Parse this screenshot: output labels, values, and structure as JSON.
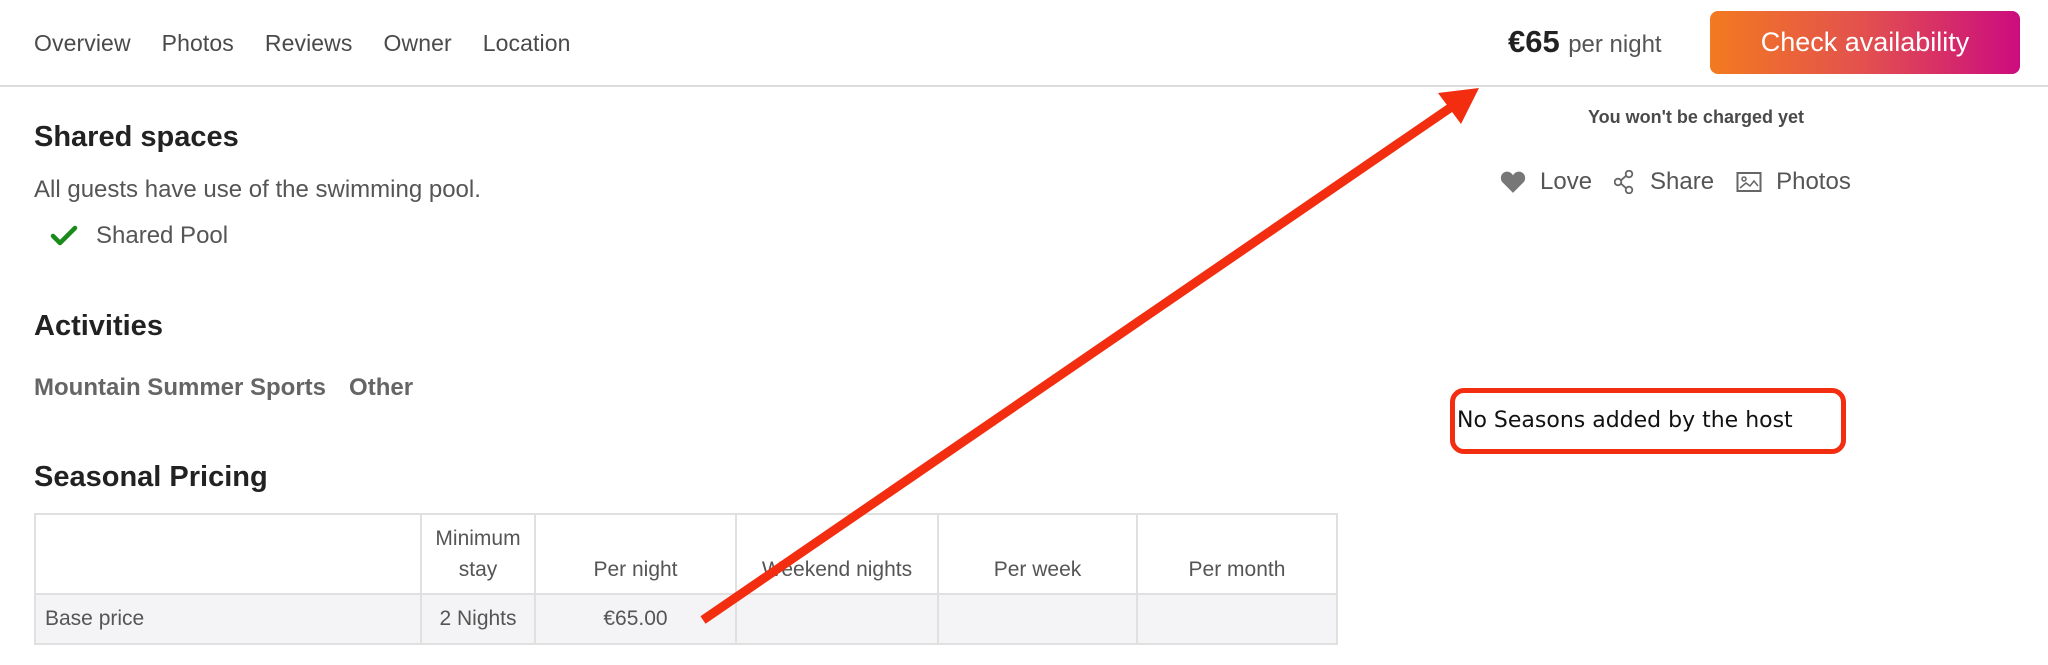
{
  "nav": {
    "tabs": [
      {
        "label": "Overview"
      },
      {
        "label": "Photos"
      },
      {
        "label": "Reviews"
      },
      {
        "label": "Owner"
      },
      {
        "label": "Location"
      }
    ]
  },
  "booking": {
    "price": "€65",
    "price_unit": "per night",
    "cta_label": "Check availability",
    "charge_note": "You won't be charged yet",
    "actions": [
      {
        "icon": "heart-icon",
        "label": "Love"
      },
      {
        "icon": "share-icon",
        "label": "Share"
      },
      {
        "icon": "image-icon",
        "label": "Photos"
      }
    ]
  },
  "shared_spaces": {
    "title": "Shared spaces",
    "description": "All guests have use of the swimming pool.",
    "amenities": [
      {
        "icon": "checkmark-icon",
        "label": "Shared Pool"
      }
    ]
  },
  "activities": {
    "title": "Activities",
    "items": [
      "Mountain Summer Sports",
      "Other"
    ]
  },
  "seasonal_pricing": {
    "title": "Seasonal Pricing",
    "headers": [
      "",
      "Minimum stay",
      "Per night",
      "Weekend nights",
      "Per week",
      "Per month"
    ],
    "rows": [
      {
        "cells": [
          "Base price",
          "2 Nights",
          "€65.00",
          "",
          "",
          ""
        ]
      }
    ]
  },
  "annotation": {
    "note": "No Seasons added by the host"
  },
  "colors": {
    "cta_gradient_start": "#f37a20",
    "cta_gradient_end": "#cb0c7f",
    "check_green": "#1a8a1a",
    "annotation_red": "#f32d10"
  }
}
